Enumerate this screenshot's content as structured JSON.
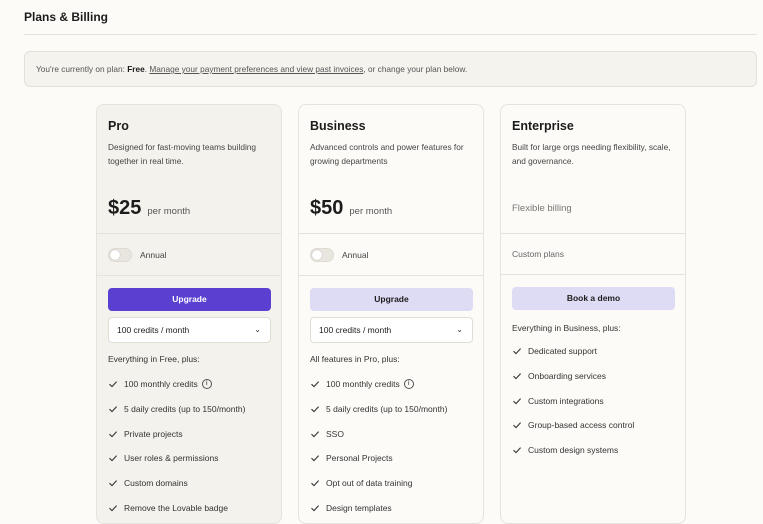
{
  "page": {
    "title": "Plans & Billing"
  },
  "notice": {
    "prefix": "You're currently on plan: ",
    "plan": "Free",
    "dot": ". ",
    "link": "Manage your payment preferences and view past invoices",
    "suffix": ", or change your plan below."
  },
  "plans": [
    {
      "title": "Pro",
      "desc": "Designed for fast-moving teams building together in real time.",
      "price": "$25",
      "per": "per month",
      "toggle_label": "Annual",
      "button": "Upgrade",
      "credits": "100 credits / month",
      "features_heading": "Everything in Free, plus:",
      "features": [
        "100 monthly credits",
        "5 daily credits (up to 150/month)",
        "Private projects",
        "User roles & permissions",
        "Custom domains",
        "Remove the Lovable badge"
      ]
    },
    {
      "title": "Business",
      "desc": "Advanced controls and power features for growing departments",
      "price": "$50",
      "per": "per month",
      "toggle_label": "Annual",
      "button": "Upgrade",
      "credits": "100 credits / month",
      "features_heading": "All features in Pro, plus:",
      "features": [
        "100 monthly credits",
        "5 daily credits (up to 150/month)",
        "SSO",
        "Personal Projects",
        "Opt out of data training",
        "Design templates"
      ]
    },
    {
      "title": "Enterprise",
      "desc": "Built for large orgs needing flexibility, scale, and governance.",
      "billing": "Flexible billing",
      "custom_plans": "Custom plans",
      "button": "Book a demo",
      "features_heading": "Everything in Business, plus:",
      "features": [
        "Dedicated support",
        "Onboarding services",
        "Custom integrations",
        "Group-based access control",
        "Custom design systems"
      ]
    }
  ],
  "icons": {
    "check": "check-icon",
    "info": "info-icon",
    "chevron": "chevron-down-icon"
  },
  "colors": {
    "primary_button": "#5a3fd0",
    "secondary_button": "#dedbf4",
    "background": "#fcfbf8"
  }
}
